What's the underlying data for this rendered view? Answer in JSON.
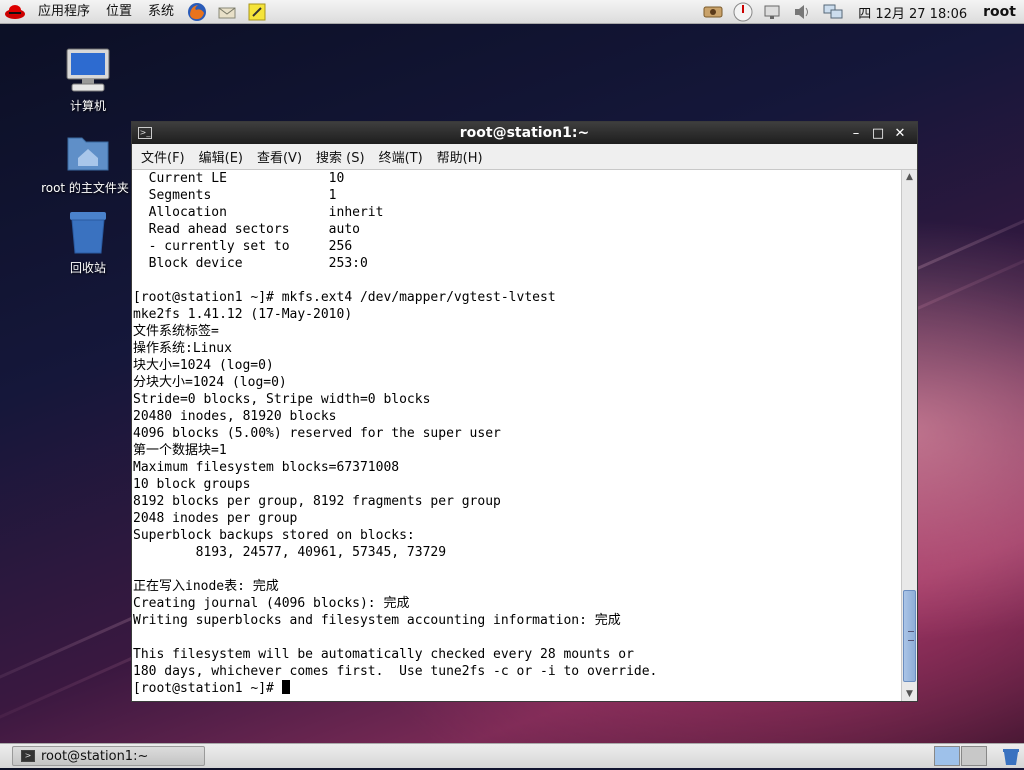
{
  "top_panel": {
    "menus": [
      "应用程序",
      "位置",
      "系统"
    ],
    "launchers": [
      "firefox-icon",
      "mail-icon",
      "notes-icon"
    ],
    "tray_icons": [
      "network-icon",
      "update-icon",
      "display-icon",
      "volume-icon",
      "network-manager-icon"
    ],
    "clock": "四 12月 27 18:06",
    "user": "root"
  },
  "desktop": {
    "icons": [
      {
        "label": "计算机"
      },
      {
        "label": "root 的主文件夹"
      },
      {
        "label": "回收站"
      }
    ]
  },
  "terminal": {
    "title": "root@station1:~",
    "menu": [
      "文件(F)",
      "编辑(E)",
      "查看(V)",
      "搜索 (S)",
      "终端(T)",
      "帮助(H)"
    ],
    "lines": [
      "  Current LE             10",
      "  Segments               1",
      "  Allocation             inherit",
      "  Read ahead sectors     auto",
      "  - currently set to     256",
      "  Block device           253:0",
      "",
      "[root@station1 ~]# mkfs.ext4 /dev/mapper/vgtest-lvtest",
      "mke2fs 1.41.12 (17-May-2010)",
      "文件系统标签=",
      "操作系统:Linux",
      "块大小=1024 (log=0)",
      "分块大小=1024 (log=0)",
      "Stride=0 blocks, Stripe width=0 blocks",
      "20480 inodes, 81920 blocks",
      "4096 blocks (5.00%) reserved for the super user",
      "第一个数据块=1",
      "Maximum filesystem blocks=67371008",
      "10 block groups",
      "8192 blocks per group, 8192 fragments per group",
      "2048 inodes per group",
      "Superblock backups stored on blocks:",
      "        8193, 24577, 40961, 57345, 73729",
      "",
      "正在写入inode表: 完成",
      "Creating journal (4096 blocks): 完成",
      "Writing superblocks and filesystem accounting information: 完成",
      "",
      "This filesystem will be automatically checked every 28 mounts or",
      "180 days, whichever comes first.  Use tune2fs -c or -i to override."
    ],
    "prompt": "[root@station1 ~]# "
  },
  "taskbar": {
    "task_label": "root@station1:~"
  }
}
